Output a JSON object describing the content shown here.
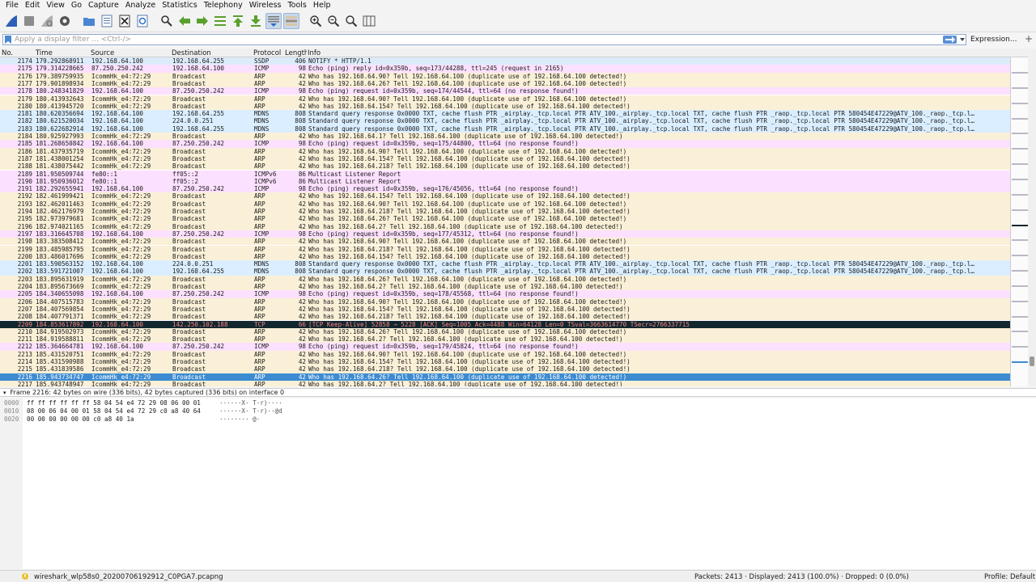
{
  "menu": [
    "File",
    "Edit",
    "View",
    "Go",
    "Capture",
    "Analyze",
    "Statistics",
    "Telephony",
    "Wireless",
    "Tools",
    "Help"
  ],
  "toolbar_icons": [
    "shark-fin-start-icon",
    "stop-capture-icon",
    "restart-capture-icon",
    "capture-options-icon",
    "open-file-icon",
    "save-file-icon",
    "close-file-icon",
    "reload-file-icon",
    "find-packet-icon",
    "go-back-icon",
    "go-forward-icon",
    "go-to-packet-icon",
    "go-first-icon",
    "go-last-icon",
    "autoscroll-icon",
    "colorize-icon",
    "zoom-in-icon",
    "zoom-out-icon",
    "zoom-normal-icon",
    "resize-columns-icon"
  ],
  "filter": {
    "placeholder": "Apply a display filter ... <Ctrl-/>",
    "expression_label": "Expression...",
    "add_label": "+"
  },
  "columns": [
    "No.",
    "Time",
    "Source",
    "Destination",
    "Protocol",
    "Length",
    "Info"
  ],
  "colors": {
    "ssdp": "#dcebfa",
    "icmp": "#fce0ff",
    "arp": "#faf0d7",
    "mdns": "#daeeff",
    "icmpv6": "#fce0ff",
    "tcp_bad": "#12272e",
    "tcp_bad_text": "#f78787",
    "selected": "#3d8bd1",
    "selected_text": "#ffffff"
  },
  "rows": [
    {
      "no": "2174",
      "time": "179.292868911",
      "src": "192.168.64.100",
      "dst": "192.168.64.255",
      "proto": "SSDP",
      "len": "406",
      "info": "NOTIFY * HTTP/1.1",
      "kind": "ssdp"
    },
    {
      "no": "2175",
      "time": "179.314228665",
      "src": "87.250.250.242",
      "dst": "192.168.64.100",
      "proto": "ICMP",
      "len": "98",
      "info": "Echo (ping) reply    id=0x359b, seq=173/44288, ttl=245 (request in 2165)",
      "kind": "icmp"
    },
    {
      "no": "2176",
      "time": "179.389759935",
      "src": "IcommHk_e4:72:29",
      "dst": "Broadcast",
      "proto": "ARP",
      "len": "42",
      "info": "Who has 192.168.64.90? Tell 192.168.64.100 (duplicate use of 192.168.64.100 detected!)",
      "kind": "arp"
    },
    {
      "no": "2177",
      "time": "179.901898934",
      "src": "IcommHk_e4:72:29",
      "dst": "Broadcast",
      "proto": "ARP",
      "len": "42",
      "info": "Who has 192.168.64.26? Tell 192.168.64.100 (duplicate use of 192.168.64.100 detected!)",
      "kind": "arp"
    },
    {
      "no": "2178",
      "time": "180.248341829",
      "src": "192.168.64.100",
      "dst": "87.250.250.242",
      "proto": "ICMP",
      "len": "98",
      "info": "Echo (ping) request  id=0x359b, seq=174/44544, ttl=64 (no response found!)",
      "kind": "icmp"
    },
    {
      "no": "2179",
      "time": "180.413932643",
      "src": "IcommHk_e4:72:29",
      "dst": "Broadcast",
      "proto": "ARP",
      "len": "42",
      "info": "Who has 192.168.64.90? Tell 192.168.64.100 (duplicate use of 192.168.64.100 detected!)",
      "kind": "arp"
    },
    {
      "no": "2180",
      "time": "180.413945720",
      "src": "IcommHk_e4:72:29",
      "dst": "Broadcast",
      "proto": "ARP",
      "len": "42",
      "info": "Who has 192.168.64.154? Tell 192.168.64.100 (duplicate use of 192.168.64.100 detected!)",
      "kind": "arp"
    },
    {
      "no": "2181",
      "time": "180.620356694",
      "src": "192.168.64.100",
      "dst": "192.168.64.255",
      "proto": "MDNS",
      "len": "808",
      "info": "Standard query response 0x0000 TXT, cache flush PTR _airplay._tcp.local PTR ATV_100._airplay._tcp.local TXT, cache flush PTR _raop._tcp.local PTR 580454E47229@ATV_100._raop._tcp.l…",
      "kind": "mdns"
    },
    {
      "no": "2182",
      "time": "180.621520034",
      "src": "192.168.64.100",
      "dst": "224.0.0.251",
      "proto": "MDNS",
      "len": "808",
      "info": "Standard query response 0x0000 TXT, cache flush PTR _airplay._tcp.local PTR ATV_100._airplay._tcp.local TXT, cache flush PTR _raop._tcp.local PTR 580454E47229@ATV_100._raop._tcp.l…",
      "kind": "mdns"
    },
    {
      "no": "2183",
      "time": "180.622682914",
      "src": "192.168.64.100",
      "dst": "192.168.64.255",
      "proto": "MDNS",
      "len": "808",
      "info": "Standard query response 0x0000 TXT, cache flush PTR _airplay._tcp.local PTR ATV_100._airplay._tcp.local TXT, cache flush PTR _raop._tcp.local PTR 580454E47229@ATV_100._raop._tcp.l…",
      "kind": "mdns"
    },
    {
      "no": "2184",
      "time": "180.925927993",
      "src": "IcommHk_e4:72:29",
      "dst": "Broadcast",
      "proto": "ARP",
      "len": "42",
      "info": "Who has 192.168.64.1? Tell 192.168.64.100 (duplicate use of 192.168.64.100 detected!)",
      "kind": "arp"
    },
    {
      "no": "2185",
      "time": "181.268650842",
      "src": "192.168.64.100",
      "dst": "87.250.250.242",
      "proto": "ICMP",
      "len": "98",
      "info": "Echo (ping) request  id=0x359b, seq=175/44800, ttl=64 (no response found!)",
      "kind": "icmp"
    },
    {
      "no": "2186",
      "time": "181.437935719",
      "src": "IcommHk_e4:72:29",
      "dst": "Broadcast",
      "proto": "ARP",
      "len": "42",
      "info": "Who has 192.168.64.90? Tell 192.168.64.100 (duplicate use of 192.168.64.100 detected!)",
      "kind": "arp"
    },
    {
      "no": "2187",
      "time": "181.438001254",
      "src": "IcommHk_e4:72:29",
      "dst": "Broadcast",
      "proto": "ARP",
      "len": "42",
      "info": "Who has 192.168.64.154? Tell 192.168.64.100 (duplicate use of 192.168.64.100 detected!)",
      "kind": "arp"
    },
    {
      "no": "2188",
      "time": "181.438075442",
      "src": "IcommHk_e4:72:29",
      "dst": "Broadcast",
      "proto": "ARP",
      "len": "42",
      "info": "Who has 192.168.64.218? Tell 192.168.64.100 (duplicate use of 192.168.64.100 detected!)",
      "kind": "arp"
    },
    {
      "no": "2189",
      "time": "181.950509744",
      "src": "fe80::1",
      "dst": "ff05::2",
      "proto": "ICMPv6",
      "len": "86",
      "info": "Multicast Listener Report",
      "kind": "icmpv6"
    },
    {
      "no": "2190",
      "time": "181.950936012",
      "src": "fe80::1",
      "dst": "ff05::2",
      "proto": "ICMPv6",
      "len": "86",
      "info": "Multicast Listener Report",
      "kind": "icmpv6"
    },
    {
      "no": "2191",
      "time": "182.292655941",
      "src": "192.168.64.100",
      "dst": "87.250.250.242",
      "proto": "ICMP",
      "len": "98",
      "info": "Echo (ping) request  id=0x359b, seq=176/45056, ttl=64 (no response found!)",
      "kind": "icmp"
    },
    {
      "no": "2192",
      "time": "182.461999421",
      "src": "IcommHk_e4:72:29",
      "dst": "Broadcast",
      "proto": "ARP",
      "len": "42",
      "info": "Who has 192.168.64.154? Tell 192.168.64.100 (duplicate use of 192.168.64.100 detected!)",
      "kind": "arp"
    },
    {
      "no": "2193",
      "time": "182.462011463",
      "src": "IcommHk_e4:72:29",
      "dst": "Broadcast",
      "proto": "ARP",
      "len": "42",
      "info": "Who has 192.168.64.90? Tell 192.168.64.100 (duplicate use of 192.168.64.100 detected!)",
      "kind": "arp"
    },
    {
      "no": "2194",
      "time": "182.462176979",
      "src": "IcommHk_e4:72:29",
      "dst": "Broadcast",
      "proto": "ARP",
      "len": "42",
      "info": "Who has 192.168.64.218? Tell 192.168.64.100 (duplicate use of 192.168.64.100 detected!)",
      "kind": "arp"
    },
    {
      "no": "2195",
      "time": "182.973979681",
      "src": "IcommHk_e4:72:29",
      "dst": "Broadcast",
      "proto": "ARP",
      "len": "42",
      "info": "Who has 192.168.64.26? Tell 192.168.64.100 (duplicate use of 192.168.64.100 detected!)",
      "kind": "arp"
    },
    {
      "no": "2196",
      "time": "182.974021165",
      "src": "IcommHk_e4:72:29",
      "dst": "Broadcast",
      "proto": "ARP",
      "len": "42",
      "info": "Who has 192.168.64.2? Tell 192.168.64.100 (duplicate use of 192.168.64.100 detected!)",
      "kind": "arp"
    },
    {
      "no": "2197",
      "time": "183.316645708",
      "src": "192.168.64.100",
      "dst": "87.250.250.242",
      "proto": "ICMP",
      "len": "98",
      "info": "Echo (ping) request  id=0x359b, seq=177/45312, ttl=64 (no response found!)",
      "kind": "icmp"
    },
    {
      "no": "2198",
      "time": "183.383508412",
      "src": "IcommHk_e4:72:29",
      "dst": "Broadcast",
      "proto": "ARP",
      "len": "42",
      "info": "Who has 192.168.64.90? Tell 192.168.64.100 (duplicate use of 192.168.64.100 detected!)",
      "kind": "arp"
    },
    {
      "no": "2199",
      "time": "183.485985795",
      "src": "IcommHk_e4:72:29",
      "dst": "Broadcast",
      "proto": "ARP",
      "len": "42",
      "info": "Who has 192.168.64.218? Tell 192.168.64.100 (duplicate use of 192.168.64.100 detected!)",
      "kind": "arp"
    },
    {
      "no": "2200",
      "time": "183.486017696",
      "src": "IcommHk_e4:72:29",
      "dst": "Broadcast",
      "proto": "ARP",
      "len": "42",
      "info": "Who has 192.168.64.154? Tell 192.168.64.100 (duplicate use of 192.168.64.100 detected!)",
      "kind": "arp"
    },
    {
      "no": "2201",
      "time": "183.590563152",
      "src": "192.168.64.100",
      "dst": "224.0.0.251",
      "proto": "MDNS",
      "len": "808",
      "info": "Standard query response 0x0000 TXT, cache flush PTR _airplay._tcp.local PTR ATV_100._airplay._tcp.local TXT, cache flush PTR _raop._tcp.local PTR 580454E47229@ATV_100._raop._tcp.l…",
      "kind": "mdns"
    },
    {
      "no": "2202",
      "time": "183.591721007",
      "src": "192.168.64.100",
      "dst": "192.168.64.255",
      "proto": "MDNS",
      "len": "808",
      "info": "Standard query response 0x0000 TXT, cache flush PTR _airplay._tcp.local PTR ATV_100._airplay._tcp.local TXT, cache flush PTR _raop._tcp.local PTR 580454E47229@ATV_100._raop._tcp.l…",
      "kind": "mdns"
    },
    {
      "no": "2203",
      "time": "183.895631919",
      "src": "IcommHk_e4:72:29",
      "dst": "Broadcast",
      "proto": "ARP",
      "len": "42",
      "info": "Who has 192.168.64.26? Tell 192.168.64.100 (duplicate use of 192.168.64.100 detected!)",
      "kind": "arp"
    },
    {
      "no": "2204",
      "time": "183.895673669",
      "src": "IcommHk_e4:72:29",
      "dst": "Broadcast",
      "proto": "ARP",
      "len": "42",
      "info": "Who has 192.168.64.2? Tell 192.168.64.100 (duplicate use of 192.168.64.100 detected!)",
      "kind": "arp"
    },
    {
      "no": "2205",
      "time": "184.340655098",
      "src": "192.168.64.100",
      "dst": "87.250.250.242",
      "proto": "ICMP",
      "len": "98",
      "info": "Echo (ping) request  id=0x359b, seq=178/45568, ttl=64 (no response found!)",
      "kind": "icmp"
    },
    {
      "no": "2206",
      "time": "184.407515783",
      "src": "IcommHk_e4:72:29",
      "dst": "Broadcast",
      "proto": "ARP",
      "len": "42",
      "info": "Who has 192.168.64.90? Tell 192.168.64.100 (duplicate use of 192.168.64.100 detected!)",
      "kind": "arp"
    },
    {
      "no": "2207",
      "time": "184.407569854",
      "src": "IcommHk_e4:72:29",
      "dst": "Broadcast",
      "proto": "ARP",
      "len": "42",
      "info": "Who has 192.168.64.154? Tell 192.168.64.100 (duplicate use of 192.168.64.100 detected!)",
      "kind": "arp"
    },
    {
      "no": "2208",
      "time": "184.407791371",
      "src": "IcommHk_e4:72:29",
      "dst": "Broadcast",
      "proto": "ARP",
      "len": "42",
      "info": "Who has 192.168.64.218? Tell 192.168.64.100 (duplicate use of 192.168.64.100 detected!)",
      "kind": "arp"
    },
    {
      "no": "2209",
      "time": "184.853617892",
      "src": "192.168.64.100",
      "dst": "142.250.102.188",
      "proto": "TCP",
      "len": "66",
      "info": "[TCP Keep-Alive] 52858 → 5228 [ACK] Seq=1005 Ack=4488 Win=64128 Len=0 TSval=3663614770 TSecr=2766337715",
      "kind": "tcp_bad"
    },
    {
      "no": "2210",
      "time": "184.919502973",
      "src": "IcommHk_e4:72:29",
      "dst": "Broadcast",
      "proto": "ARP",
      "len": "42",
      "info": "Who has 192.168.64.26? Tell 192.168.64.100 (duplicate use of 192.168.64.100 detected!)",
      "kind": "arp"
    },
    {
      "no": "2211",
      "time": "184.919588811",
      "src": "IcommHk_e4:72:29",
      "dst": "Broadcast",
      "proto": "ARP",
      "len": "42",
      "info": "Who has 192.168.64.2? Tell 192.168.64.100 (duplicate use of 192.168.64.100 detected!)",
      "kind": "arp"
    },
    {
      "no": "2212",
      "time": "185.364664781",
      "src": "192.168.64.100",
      "dst": "87.250.250.242",
      "proto": "ICMP",
      "len": "98",
      "info": "Echo (ping) request  id=0x359b, seq=179/45824, ttl=64 (no response found!)",
      "kind": "icmp"
    },
    {
      "no": "2213",
      "time": "185.431520751",
      "src": "IcommHk_e4:72:29",
      "dst": "Broadcast",
      "proto": "ARP",
      "len": "42",
      "info": "Who has 192.168.64.90? Tell 192.168.64.100 (duplicate use of 192.168.64.100 detected!)",
      "kind": "arp"
    },
    {
      "no": "2214",
      "time": "185.431590988",
      "src": "IcommHk_e4:72:29",
      "dst": "Broadcast",
      "proto": "ARP",
      "len": "42",
      "info": "Who has 192.168.64.154? Tell 192.168.64.100 (duplicate use of 192.168.64.100 detected!)",
      "kind": "arp"
    },
    {
      "no": "2215",
      "time": "185.431839586",
      "src": "IcommHk_e4:72:29",
      "dst": "Broadcast",
      "proto": "ARP",
      "len": "42",
      "info": "Who has 192.168.64.218? Tell 192.168.64.100 (duplicate use of 192.168.64.100 detected!)",
      "kind": "arp"
    },
    {
      "no": "2216",
      "time": "185.943734747",
      "src": "IcommHk_e4:72:29",
      "dst": "Broadcast",
      "proto": "ARP",
      "len": "42",
      "info": "Who has 192.168.64.26? Tell 192.168.64.100 (duplicate use of 192.168.64.100 detected!)",
      "kind": "selected"
    },
    {
      "no": "2217",
      "time": "185.943748947",
      "src": "IcommHk_e4:72:29",
      "dst": "Broadcast",
      "proto": "ARP",
      "len": "42",
      "info": "Who has 192.168.64.2? Tell 192.168.64.100 (duplicate use of 192.168.64.100 detected!)",
      "kind": "arp"
    }
  ],
  "detail": {
    "frame_summary": "Frame 2216: 42 bytes on wire (336 bits), 42 bytes captured (336 bits) on interface 0"
  },
  "bytes": [
    {
      "offset": "0000",
      "hex": "ff ff ff ff ff ff 58 04  54 e4 72 29 08 06 00 01",
      "ascii": "······X· T·r)····"
    },
    {
      "offset": "0010",
      "hex": "08 00 06 04 00 01 58 04  54 e4 72 29 c0 a8 40 64",
      "ascii": "······X· T·r)··@d"
    },
    {
      "offset": "0020",
      "hex": "00 00 00 00 00 00 c0 a8  40 1a",
      "ascii": "········ @·"
    }
  ],
  "status": {
    "file_name": "wireshark_wlp58s0_20200706192912_C0PGA7.pcapng",
    "counts": "Packets: 2413 · Displayed: 2413 (100.0%) · Dropped: 0 (0.0%)",
    "profile": "Profile: Default"
  }
}
